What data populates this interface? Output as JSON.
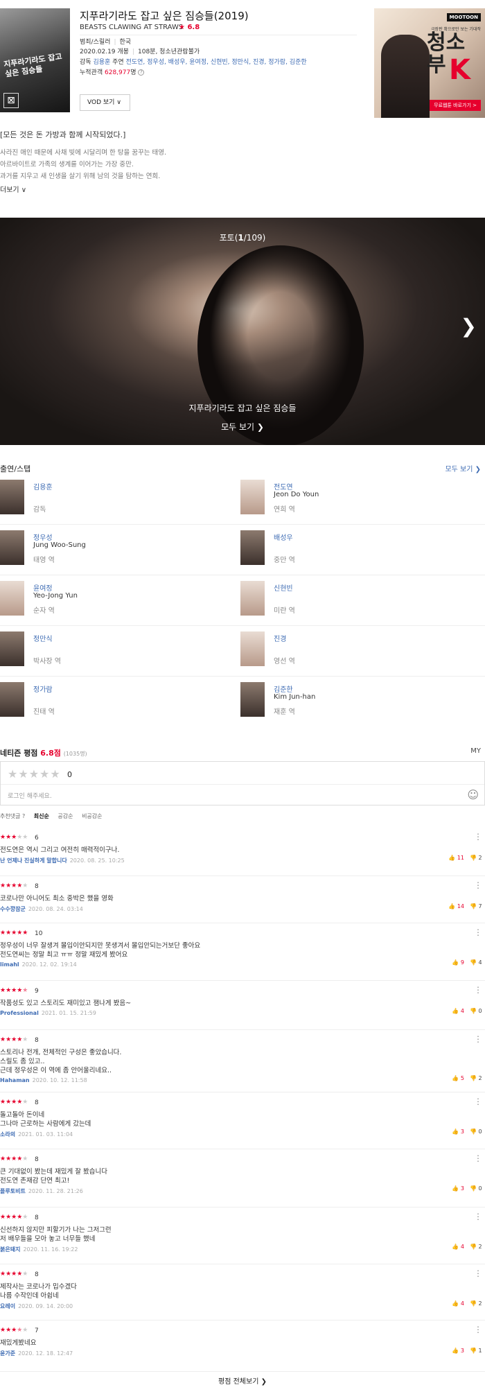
{
  "movie": {
    "title": "지푸라기라도 잡고 싶은 짐승들(2019)",
    "en_title": "BEASTS CLAWING AT STRAWS",
    "rating": "★ 6.8",
    "genre": "범죄/스릴러",
    "country": "한국",
    "release": "2020.02.19 개봉",
    "runtime": "108분, 청소년관람불가",
    "director_label": "감독",
    "director": "김용훈",
    "cast_label": "주연",
    "cast_names": "전도연, 정우성, 배성우, 윤여정, 신현빈, 정만식, 진경, 정가람, 김준한",
    "audience_label": "누적관객",
    "audience": "628,977",
    "audience_unit": "명",
    "vod_button": "VOD 보기",
    "poster_text": "지푸라기라도 잡고 싶은 짐승들"
  },
  "ad": {
    "logo": "MOOTOON",
    "copy": "극장판 확으로만 보는 기대작",
    "title_line1": "청소",
    "title_line2": "부",
    "k": "K",
    "button": "무료웹툰 바로가기 >"
  },
  "synopsis": {
    "heading": "[모든 것은 돈 가방과 함께 시작되었다.]",
    "lines": [
      "사라진 애인 때문에 사채 빚에 시달리며 한 탕을 꿈꾸는 태영.",
      "아르바이트로 가족의 생계를 이어가는 가장 중만.",
      "과거를 지우고 새 인생을 살기 위해 남의 것을 탐하는 연희."
    ],
    "more": "더보기 ∨"
  },
  "photo": {
    "counter_prefix": "포토(",
    "counter_current": "1",
    "counter_suffix": "/109)",
    "caption": "지푸라기라도 잡고 싶은 짐승들",
    "see_all": "모두 보기 ❯",
    "next": "❯"
  },
  "cast_section": {
    "title": "출연/스탭",
    "more": "모두 보기 ❯",
    "people": [
      {
        "name": "김용훈",
        "en": "",
        "role": "감독"
      },
      {
        "name": "전도연",
        "en": "Jeon Do Youn",
        "role": "연희 역"
      },
      {
        "name": "정우성",
        "en": "Jung Woo-Sung",
        "role": "태영 역"
      },
      {
        "name": "배성우",
        "en": "",
        "role": "중만 역"
      },
      {
        "name": "윤여정",
        "en": "Yeo-Jong Yun",
        "role": "순자 역"
      },
      {
        "name": "신현빈",
        "en": "",
        "role": "미란 역"
      },
      {
        "name": "정만식",
        "en": "",
        "role": "박사장 역"
      },
      {
        "name": "진경",
        "en": "",
        "role": "영선 역"
      },
      {
        "name": "정가람",
        "en": "",
        "role": "진태 역"
      },
      {
        "name": "김준한",
        "en": "Kim Jun-han",
        "role": "재훈 역"
      }
    ]
  },
  "netizen": {
    "title": "네티즌 평점 ",
    "score": "6.8점",
    "count": "(1035명)",
    "my": "MY",
    "stars": "★★★★★",
    "zero": "0",
    "login_placeholder": "로그인 해주세요.",
    "smile": "☺",
    "sort": [
      "추천댓글 ?",
      "최신순",
      "공감순",
      "비공감순"
    ],
    "reviews": [
      {
        "stars": 3,
        "score": "6",
        "text": "전도연은 역시 그리고 여전히 매력적이구나.",
        "user": "난 언제나 진실하게 말합니다",
        "date": "2020. 08. 25. 10:25",
        "like": "11",
        "dislike": "2"
      },
      {
        "stars": 4,
        "score": "8",
        "text": "코로나만 아니어도 최소 중박은 했을 영화",
        "user": "수수깡잠군",
        "date": "2020. 08. 24. 03:14",
        "like": "14",
        "dislike": "7"
      },
      {
        "stars": 5,
        "score": "10",
        "text": "정우성이 너무 잘생겨 몰입이안되지만 못생겨서 몰입안되는거보단 좋아요\n전도연씨는 정말 최고 ㅠㅠ 정말 재밌게 봤어요",
        "user": "limahl",
        "date": "2020. 12. 02. 19:14",
        "like": "9",
        "dislike": "4"
      },
      {
        "stars": 4.5,
        "score": "9",
        "text": "작품성도 있고 스토리도 재미있고 잼나게 봤음~",
        "user": "Professional",
        "date": "2021. 01. 15. 21:59",
        "like": "4",
        "dislike": "0"
      },
      {
        "stars": 4,
        "score": "8",
        "text": "스토리나 전개, 전체적인 구성은 좋았습니다.\n스릴도 좀 있고..\n근데 정우성은 이 역에 좀 안어울리네요..",
        "user": "Hahaman",
        "date": "2020. 10. 12. 11:58",
        "like": "5",
        "dislike": "2"
      },
      {
        "stars": 4,
        "score": "8",
        "text": "돌고돌아 돈이네\n그나마 근로하는 사람에게 갔는데",
        "user": "소라의",
        "date": "2021. 01. 03. 11:04",
        "like": "3",
        "dislike": "0"
      },
      {
        "stars": 4,
        "score": "8",
        "text": "큰 기대없이 봤는데 재밌게 잘 봤습니다\n전도연 존재감 단연 최고!",
        "user": "플루토비트",
        "date": "2020. 11. 28. 21:26",
        "like": "3",
        "dislike": "0"
      },
      {
        "stars": 4,
        "score": "8",
        "text": "신선하지 않지만  피할기가 나는  그저그런\n저  배우들을  모아 놓고 너무들 했네",
        "user": "붉은돼지",
        "date": "2020. 11. 16. 19:22",
        "like": "4",
        "dislike": "2"
      },
      {
        "stars": 4,
        "score": "8",
        "text": "제작사는 코로나가 밉수겠다\n나름 수작인데 아쉽네",
        "user": "요레이",
        "date": "2020. 09. 14. 20:00",
        "like": "4",
        "dislike": "2"
      },
      {
        "stars": 3.5,
        "score": "7",
        "text": "재밌게봤네요",
        "user": "윤가준",
        "date": "2020. 12. 18. 12:47",
        "like": "3",
        "dislike": "1"
      }
    ],
    "see_all": "평점 전체보기 ❯"
  }
}
